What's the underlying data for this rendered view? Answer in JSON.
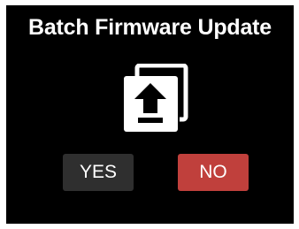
{
  "dialog": {
    "title": "Batch Firmware Update",
    "icon": "firmware-upload-icon",
    "yes_label": "YES",
    "no_label": "NO"
  },
  "colors": {
    "background": "#000000",
    "text": "#ffffff",
    "yes_button": "#2f2f2f",
    "no_button": "#c0403c"
  }
}
